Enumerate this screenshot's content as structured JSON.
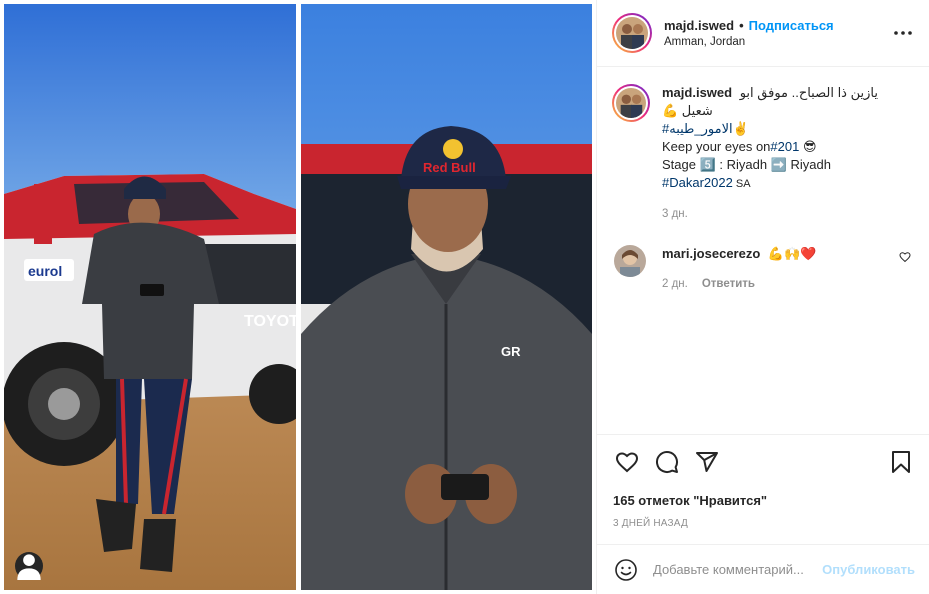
{
  "post": {
    "author": "majd.iswed",
    "separator": "•",
    "follow_label": "Подписаться",
    "location": "Amman, Jordan"
  },
  "caption": {
    "username": "majd.iswed",
    "line1": "يازين ذا الصباح.. موفق ابو",
    "line2": "شعيل 💪",
    "hashtag_line": "#الامور_طيبه✌️",
    "line4_text": "Keep your eyes on",
    "line4_tag": "#201",
    "line4_emoji": " 😎",
    "line5": "Stage 5️⃣ : Riyadh ➡️ Riyadh",
    "line6_tag": "#Dakar2022",
    "line6_flag": " SA",
    "time": "3 дн."
  },
  "comments": [
    {
      "username": "mari.josecerezo",
      "text": "💪🙌❤️",
      "time": "2 дн.",
      "reply_label": "Ответить"
    }
  ],
  "likes_label": "165 отметок \"Нравится\"",
  "posted_ago": "3 ДНЕЙ НАЗАД",
  "add_comment": {
    "placeholder": "Добавьте комментарий...",
    "post_label": "Опубликовать"
  },
  "photo_text": {
    "cap_brand": "Red Bull",
    "car_brand": "TOYOTA",
    "sponsor": "eurol",
    "jacket_logo": "GR"
  },
  "icons": {
    "more": "more-horizontal-icon",
    "like": "heart-icon",
    "comment": "comment-bubble-icon",
    "share": "paper-plane-icon",
    "save": "bookmark-icon",
    "emoji": "smiley-icon",
    "tag": "user-tag-icon"
  },
  "colors": {
    "link_blue": "#0095f6",
    "post_disabled": "#b2dffc",
    "hashtag": "#00376b",
    "muted": "#8e8e8e"
  }
}
